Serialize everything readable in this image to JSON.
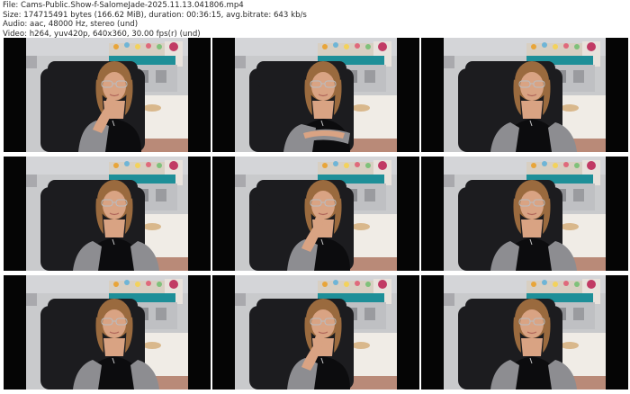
{
  "header": {
    "file_line": "File: Cams-Public.Show-f-SalomeJade-2025.11.13.041806.mp4",
    "size_line": "Size: 174715491 bytes (166.62 MiB), duration: 00:36:15, avg.bitrate: 643 kb/s",
    "audio_line": "Audio: aac, 48000 Hz, stereo (und)",
    "video_line": "Video: h264, yuv420p, 640x360, 30.00 fps(r) (und)"
  },
  "thumbnails": [
    {
      "pose": "hand-chin"
    },
    {
      "pose": "arms-crossed"
    },
    {
      "pose": "neutral"
    },
    {
      "pose": "neutral"
    },
    {
      "pose": "hand-chin"
    },
    {
      "pose": "neutral"
    },
    {
      "pose": "neutral"
    },
    {
      "pose": "hand-chin"
    },
    {
      "pose": "neutral"
    }
  ],
  "colors": {
    "wall": "#c9cacc",
    "headboard": "#1e8f98",
    "desk": "#f0ece6",
    "chair": "#1c1c1f",
    "hair": "#9a6a3e",
    "skin": "#d9a383",
    "top": "#0c0c0e",
    "cardigan": "#8d8d91",
    "frame_background": "#050505"
  }
}
